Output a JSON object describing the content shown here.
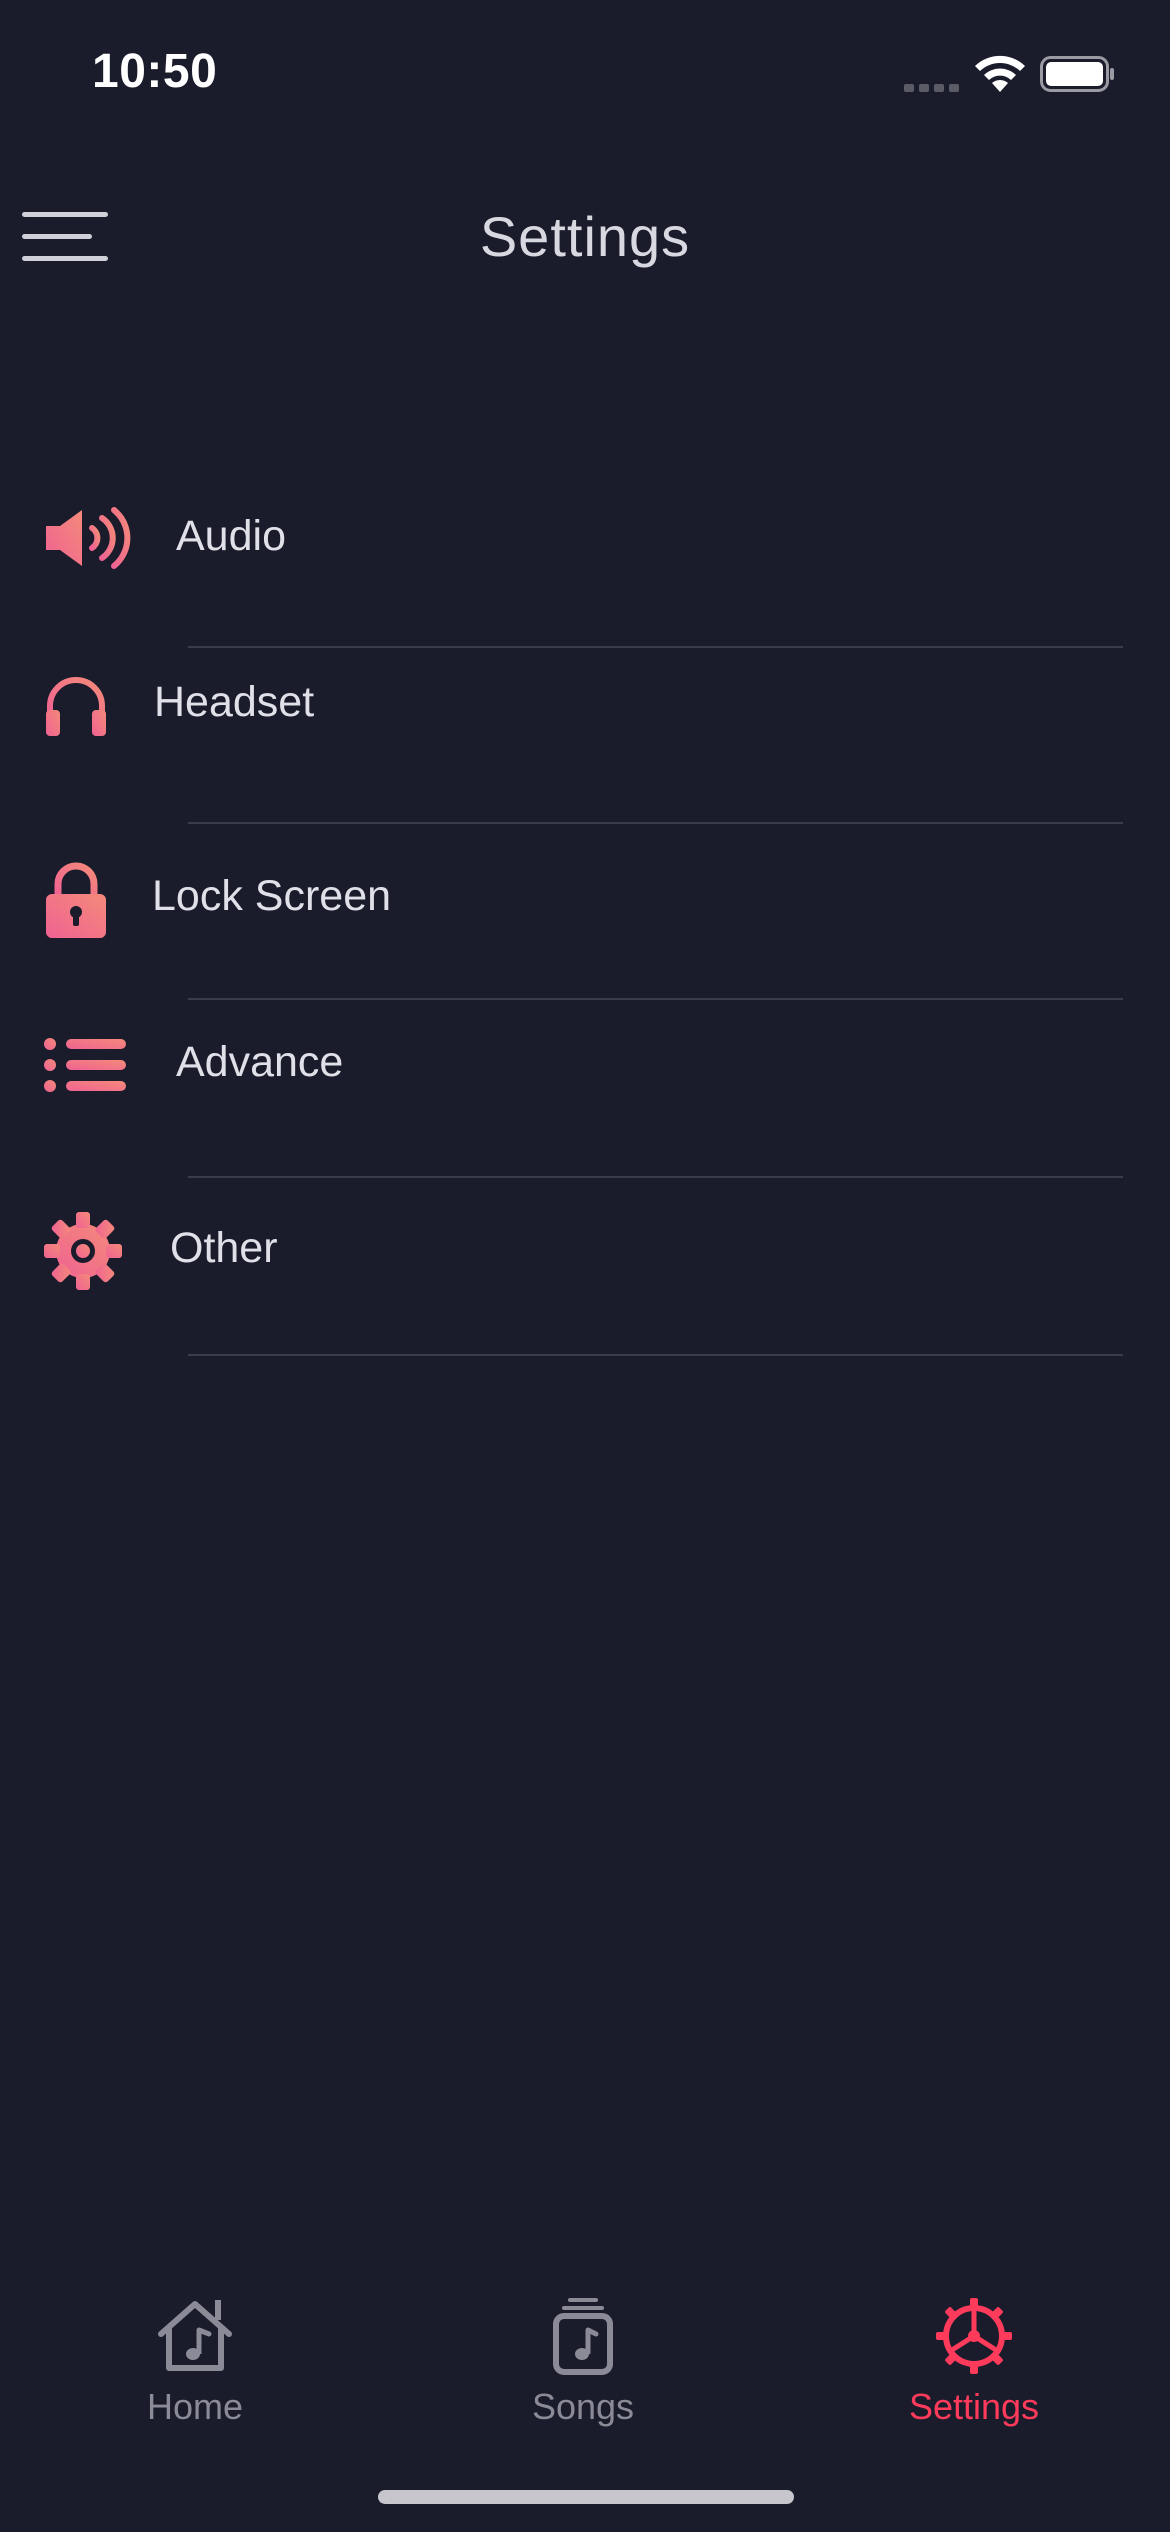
{
  "status_bar": {
    "time": "10:50"
  },
  "header": {
    "title": "Settings"
  },
  "settings": {
    "items": [
      {
        "label": "Audio",
        "icon": "speaker-icon"
      },
      {
        "label": "Headset",
        "icon": "headphones-icon"
      },
      {
        "label": "Lock Screen",
        "icon": "lock-icon"
      },
      {
        "label": "Advance",
        "icon": "list-icon"
      },
      {
        "label": "Other",
        "icon": "gear-icon"
      }
    ]
  },
  "tab_bar": {
    "tabs": [
      {
        "label": "Home",
        "icon": "home-music-icon",
        "active": false
      },
      {
        "label": "Songs",
        "icon": "songs-stack-icon",
        "active": false
      },
      {
        "label": "Settings",
        "icon": "settings-gear-icon",
        "active": true
      }
    ]
  },
  "colors": {
    "background": "#1a1b2b",
    "accent": "#ff3b5c",
    "icon_gradient_start": "#f06292",
    "icon_gradient_end": "#f48a7a",
    "inactive": "#8a8b96",
    "divider": "#3a3c4e"
  }
}
